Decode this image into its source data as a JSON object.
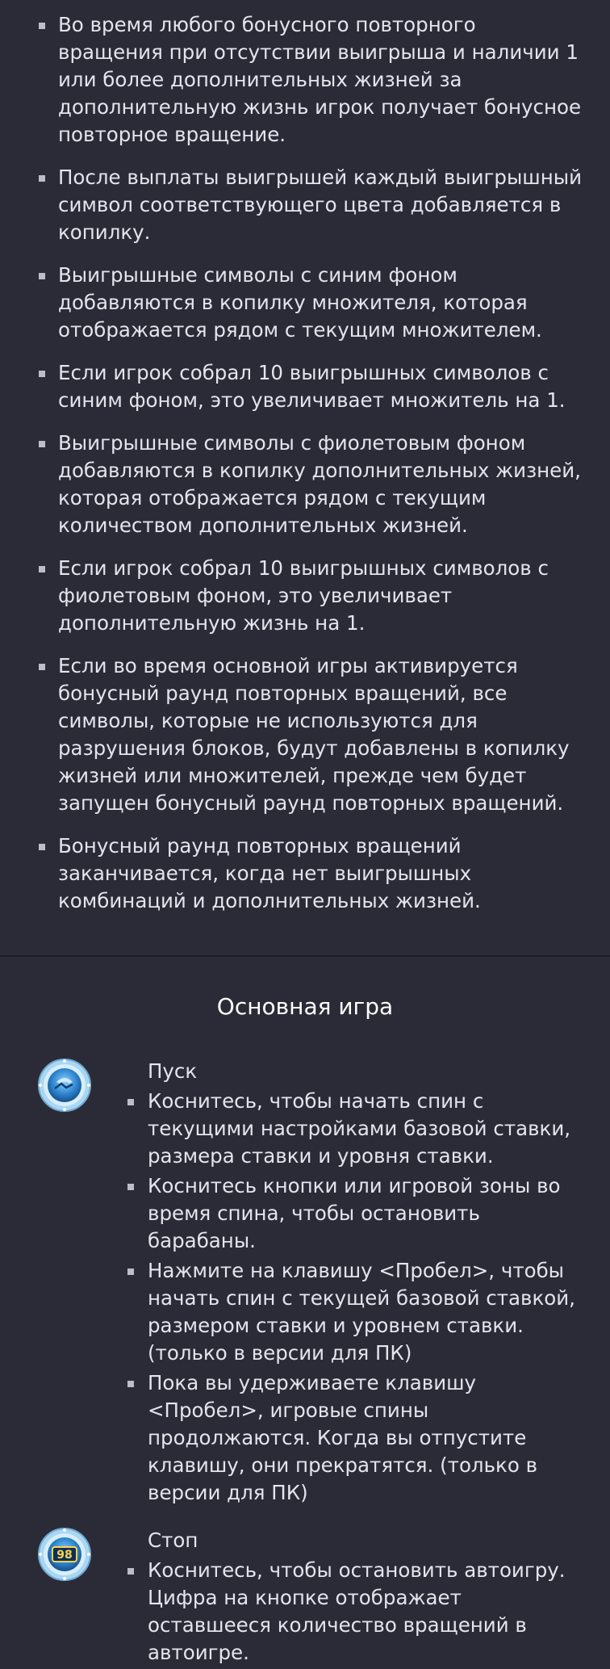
{
  "rules": [
    "Во время любого бонусного повторного вращения при отсутствии выигрыша и наличии 1 или более дополнительных жизней за дополнительную жизнь игрок получает бонусное повторное вращение.",
    "После выплаты выигрышей каждый выигрышный символ соответствующего цвета добавляется в копилку.",
    "Выигрышные символы с синим фоном добавляются в копилку множителя, которая отображается рядом с текущим множителем.",
    "Если игрок собрал 10 выигрышных символов с синим фоном, это увеличивает множитель на 1.",
    "Выигрышные символы с фиолетовым фоном добавляются в копилку дополнительных жизней, которая отображается рядом с текущим количеством дополнительных жизней.",
    "Если игрок собрал 10 выигрышных символов с фиолетовым фоном, это увеличивает дополнительную жизнь на 1.",
    "Если во время основной игры активируется бонусный раунд повторных вращений, все символы, которые не используются для разрушения блоков, будут добавлены в копилку жизней или множителей, прежде чем будет запущен бонусный раунд повторных вращений.",
    "Бонусный раунд повторных вращений заканчивается, когда нет выигрышных комбинаций и дополнительных жизней."
  ],
  "section_title": "Основная игра",
  "spin": {
    "label": "Пуск",
    "icon": "spin-button-icon",
    "items": [
      "Коснитесь, чтобы начать спин с текущими настройками базовой ставки, размера ставки и уровня ставки.",
      "Коснитесь кнопки или игровой зоны во время спина, чтобы остановить барабаны.",
      "Нажмите на клавишу <Пробел>, чтобы начать спин с текущей базовой ставкой, размером ставки и уровнем ставки. (только в версии для ПК)",
      "Пока вы удерживаете клавишу <Пробел>, игровые спины продолжаются. Когда вы отпустите клавишу, они прекратятся. (только в версии для ПК)"
    ]
  },
  "stop": {
    "label": "Стоп",
    "icon": "autoplay-stop-icon",
    "badge": "98",
    "items": [
      "Коснитесь, чтобы остановить автоигру. Цифра на кнопке отображает оставшееся количество вращений в автоигре."
    ]
  },
  "colors": {
    "background": "#2b2b38",
    "text": "#e4e4ec",
    "bullet": "#bdbdc8",
    "icon_blue": "#4aa3e0"
  }
}
